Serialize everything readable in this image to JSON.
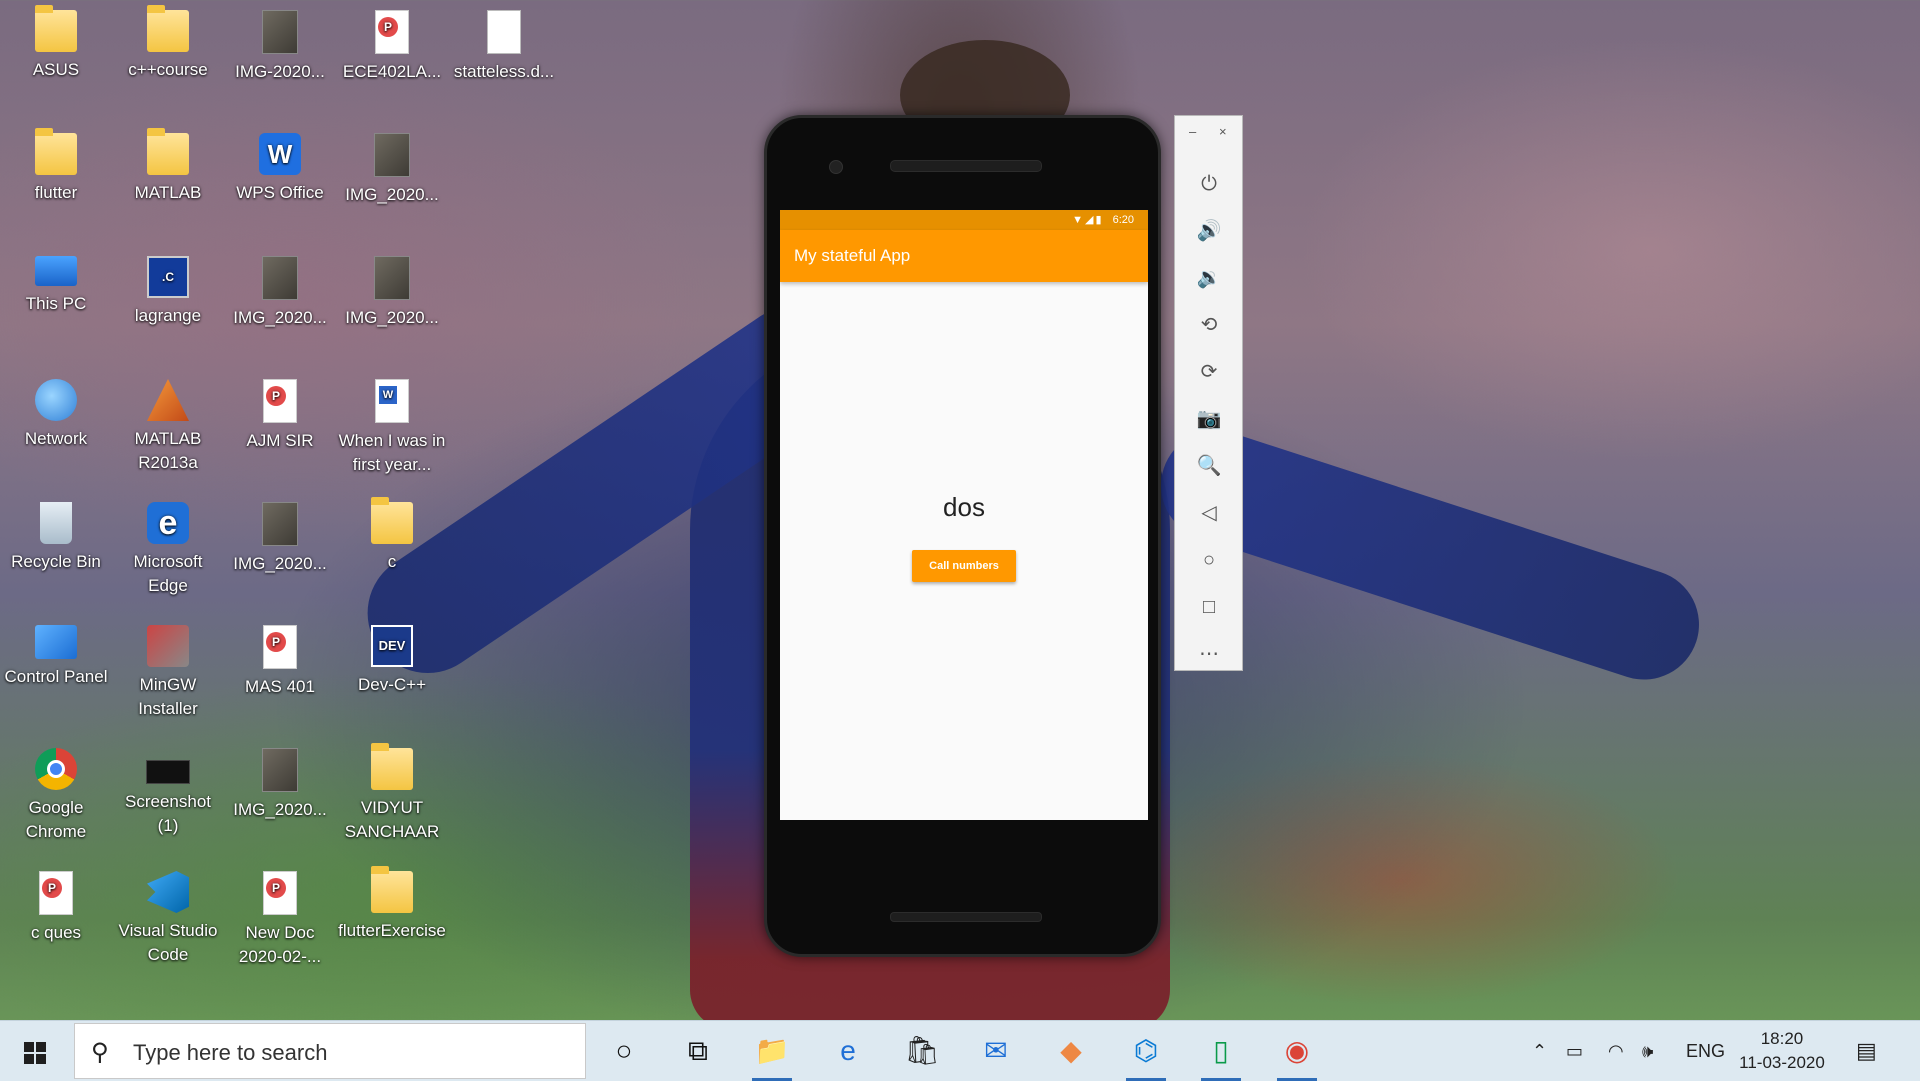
{
  "desktop": {
    "icons": [
      {
        "label": "ASUS",
        "icon": "user-folder-icon"
      },
      {
        "label": "c++course",
        "icon": "folder-icon"
      },
      {
        "label": "IMG-2020...",
        "icon": "image-file-icon"
      },
      {
        "label": "ECE402LA...",
        "icon": "pdf-file-icon"
      },
      {
        "label": "statteless.d...",
        "icon": "text-file-icon"
      },
      {
        "label": "flutter",
        "icon": "folder-icon"
      },
      {
        "label": "MATLAB",
        "icon": "folder-icon"
      },
      {
        "label": "WPS Office",
        "icon": "wps-office-icon"
      },
      {
        "label": "IMG_2020...",
        "icon": "image-file-icon"
      },
      {
        "label": "This PC",
        "icon": "this-pc-icon"
      },
      {
        "label": "lagrange",
        "icon": "c-source-file-icon"
      },
      {
        "label": "IMG_2020...",
        "icon": "image-file-icon"
      },
      {
        "label": "IMG_2020...",
        "icon": "image-file-icon"
      },
      {
        "label": "Network",
        "icon": "network-icon"
      },
      {
        "label": "MATLAB R2013a",
        "icon": "matlab-icon"
      },
      {
        "label": "AJM SIR",
        "icon": "pdf-file-icon"
      },
      {
        "label": "When I was in first year...",
        "icon": "word-file-icon"
      },
      {
        "label": "Recycle Bin",
        "icon": "recycle-bin-icon"
      },
      {
        "label": "Microsoft Edge",
        "icon": "edge-icon"
      },
      {
        "label": "IMG_2020...",
        "icon": "image-file-icon"
      },
      {
        "label": "c",
        "icon": "folder-icon"
      },
      {
        "label": "Control Panel",
        "icon": "control-panel-icon"
      },
      {
        "label": "MinGW Installer",
        "icon": "mingw-installer-icon"
      },
      {
        "label": "MAS 401",
        "icon": "pdf-file-icon"
      },
      {
        "label": "Dev-C++",
        "icon": "dev-cpp-icon"
      },
      {
        "label": "Google Chrome",
        "icon": "chrome-icon"
      },
      {
        "label": "Screenshot (1)",
        "icon": "screenshot-file-icon"
      },
      {
        "label": "IMG_2020...",
        "icon": "image-file-icon"
      },
      {
        "label": "VIDYUT SANCHAAR",
        "icon": "folder-icon"
      },
      {
        "label": "c ques",
        "icon": "pdf-file-icon"
      },
      {
        "label": "Visual Studio Code",
        "icon": "vscode-icon"
      },
      {
        "label": "New Doc 2020-02-...",
        "icon": "pdf-file-icon"
      },
      {
        "label": "flutterExercise",
        "icon": "folder-icon"
      }
    ]
  },
  "emulator": {
    "status_time": "6:20",
    "status_icons": "wifi-icon signal-icon battery-icon",
    "app_title": "My stateful App",
    "counter_text": "dos",
    "button_label": "Call numbers",
    "accent_color": "#ff9800",
    "toolbar": {
      "minimize": "–",
      "close": "×",
      "buttons": [
        {
          "name": "power-icon",
          "glyph": "⏻"
        },
        {
          "name": "volume-up-icon",
          "glyph": "🔊"
        },
        {
          "name": "volume-down-icon",
          "glyph": "🔉"
        },
        {
          "name": "rotate-left-icon",
          "glyph": "⟲"
        },
        {
          "name": "rotate-right-icon",
          "glyph": "⟳"
        },
        {
          "name": "camera-icon",
          "glyph": "📷"
        },
        {
          "name": "zoom-icon",
          "glyph": "🔍"
        },
        {
          "name": "back-icon",
          "glyph": "◁"
        },
        {
          "name": "home-icon",
          "glyph": "○"
        },
        {
          "name": "overview-icon",
          "glyph": "□"
        },
        {
          "name": "more-icon",
          "glyph": "⋯"
        }
      ]
    }
  },
  "taskbar": {
    "search_placeholder": "Type here to search",
    "apps": [
      {
        "name": "cortana-icon",
        "glyph": "○"
      },
      {
        "name": "task-view-icon",
        "glyph": "⧉"
      },
      {
        "name": "file-explorer-icon",
        "glyph": "📁"
      },
      {
        "name": "edge-icon",
        "glyph": "e"
      },
      {
        "name": "store-icon",
        "glyph": "🛍"
      },
      {
        "name": "mail-icon",
        "glyph": "✉"
      },
      {
        "name": "photos-icon",
        "glyph": "◆"
      },
      {
        "name": "vscode-icon",
        "glyph": "⌬"
      },
      {
        "name": "android-emulator-icon",
        "glyph": "▯"
      },
      {
        "name": "chrome-icon",
        "glyph": "◉"
      }
    ],
    "tray": {
      "language": "ENG",
      "time": "18:20",
      "date": "11-03-2020"
    }
  }
}
